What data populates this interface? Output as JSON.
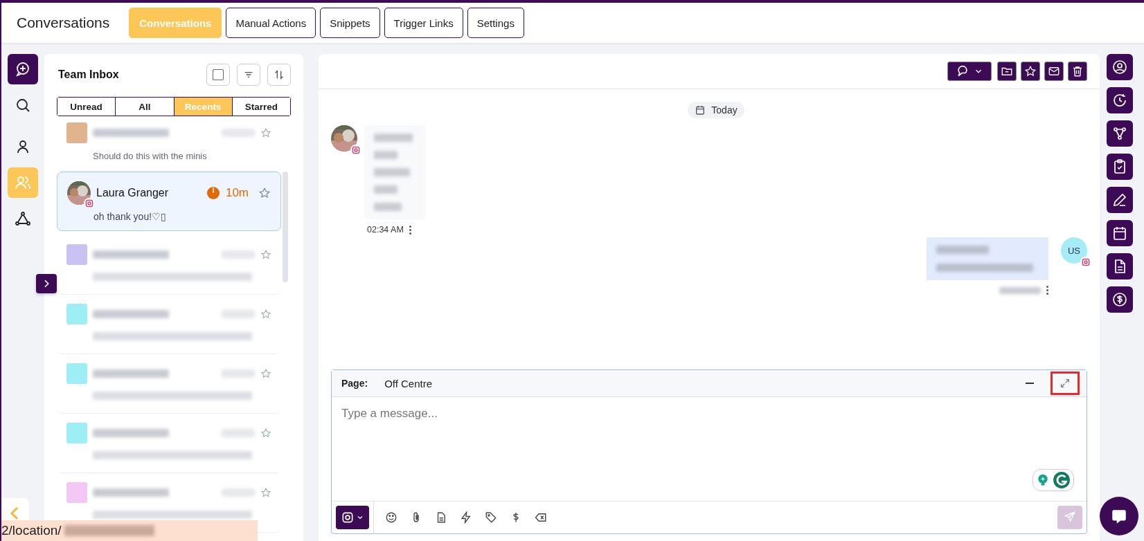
{
  "header": {
    "title": "Conversations",
    "tabs": [
      {
        "label": "Conversations",
        "selected": true
      },
      {
        "label": "Manual Actions",
        "selected": false
      },
      {
        "label": "Snippets",
        "selected": false
      },
      {
        "label": "Trigger Links",
        "selected": false
      },
      {
        "label": "Settings",
        "selected": false
      }
    ]
  },
  "left_rail": [
    {
      "kind": "compose",
      "selected": false
    },
    {
      "kind": "search",
      "selected": false
    },
    {
      "kind": "contact",
      "selected": false
    },
    {
      "kind": "team",
      "selected": true
    },
    {
      "kind": "network",
      "selected": false
    }
  ],
  "inbox": {
    "title": "Team Inbox",
    "select_all": {
      "checked": false
    },
    "filters": [
      {
        "label": "Unread",
        "selected": false
      },
      {
        "label": "All",
        "selected": false
      },
      {
        "label": "Recents",
        "selected": true
      },
      {
        "label": "Starred",
        "selected": false
      }
    ],
    "conversations": [
      {
        "kind": "blurred",
        "color": "#e0b48c",
        "preview": "Should do this with the minis",
        "selected": false,
        "starred": false
      },
      {
        "kind": "contact",
        "name": "Laura Granger",
        "time": "10m",
        "preview": "oh thank you!♡▯",
        "selected": true,
        "starred": false
      },
      {
        "kind": "blurred",
        "color": "#c9c2f2",
        "selected": false,
        "starred": false
      },
      {
        "kind": "blurred",
        "color": "#9eeef5",
        "selected": false,
        "starred": false
      },
      {
        "kind": "blurred",
        "color": "#9eeef5",
        "selected": false,
        "starred": false
      },
      {
        "kind": "blurred",
        "color": "#9eeef5",
        "selected": false,
        "starred": false
      },
      {
        "kind": "blurred",
        "color": "#f3c8f5",
        "selected": false,
        "starred": false
      }
    ]
  },
  "chat": {
    "date": "Today",
    "messages": [
      {
        "kind": "incoming",
        "time": "02:34 AM"
      },
      {
        "kind": "outgoing",
        "avatar": "US"
      }
    ]
  },
  "composer": {
    "page_label": "Page:",
    "page": "Off Centre",
    "placeholder": "Type a message..."
  },
  "status_url": "2/location/"
}
